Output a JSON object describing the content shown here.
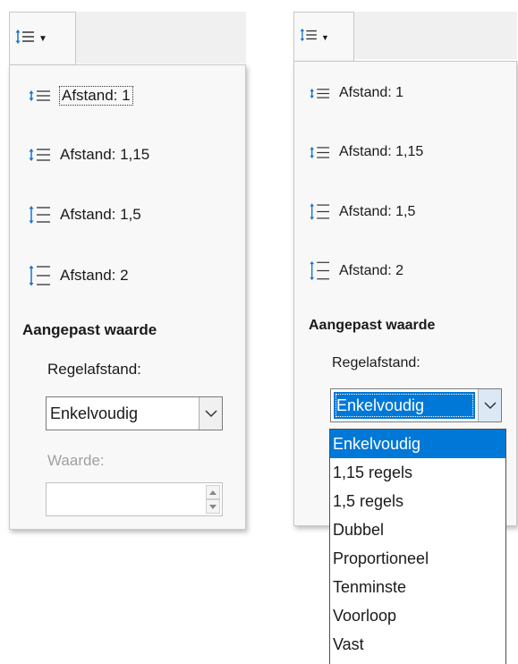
{
  "left": {
    "items": [
      {
        "label": "Afstand: 1"
      },
      {
        "label": "Afstand: 1,15"
      },
      {
        "label": "Afstand: 1,5"
      },
      {
        "label": "Afstand: 2"
      }
    ],
    "heading": "Aangepast waarde",
    "spacing_label": "Regelafstand:",
    "spacing_value": "Enkelvoudig",
    "value_label": "Waarde:",
    "value": ""
  },
  "right": {
    "items": [
      {
        "label": "Afstand: 1"
      },
      {
        "label": "Afstand: 1,15"
      },
      {
        "label": "Afstand: 1,5"
      },
      {
        "label": "Afstand: 2"
      }
    ],
    "heading": "Aangepast waarde",
    "spacing_label": "Regelafstand:",
    "spacing_value": "Enkelvoudig",
    "options": [
      "Enkelvoudig",
      "1,15 regels",
      "1,5 regels",
      "Dubbel",
      "Proportioneel",
      "Tenminste",
      "Voorloop",
      "Vast"
    ],
    "selected_index": 0
  },
  "icons": {
    "toolbar": "line-spacing-icon",
    "dropdown": "chevron-down-icon"
  },
  "colors": {
    "accent": "#0078d7",
    "icon_blue": "#1a73c8",
    "panel_bg": "#f8f8f8",
    "border": "#c8c8c8"
  }
}
